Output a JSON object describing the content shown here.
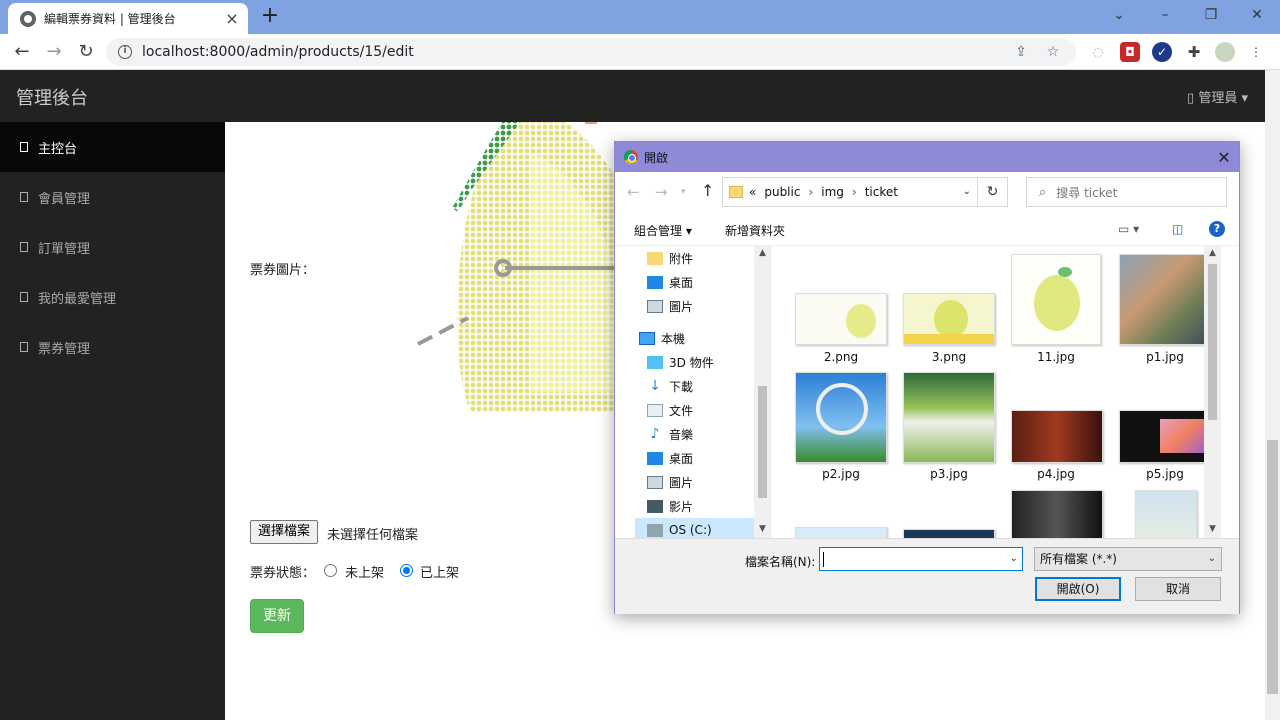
{
  "browser": {
    "tab_title": "編輯票券資料 | 管理後台",
    "url": "localhost:8000/admin/products/15/edit"
  },
  "app": {
    "brand": "管理後台",
    "admin_menu": "管理員",
    "sidebar": [
      {
        "label": "主控台",
        "active": true
      },
      {
        "label": "會員管理",
        "active": false
      },
      {
        "label": "訂單管理",
        "active": false
      },
      {
        "label": "我的最愛管理",
        "active": false
      },
      {
        "label": "票券管理",
        "active": false
      }
    ]
  },
  "form": {
    "image_label": "票券圖片：",
    "choose_file": "選擇檔案",
    "no_file": "未選擇任何檔案",
    "status_label": "票券狀態：",
    "status_options": [
      {
        "label": "未上架",
        "checked": false
      },
      {
        "label": "已上架",
        "checked": true
      }
    ],
    "submit": "更新"
  },
  "dialog": {
    "title": "開啟",
    "path": [
      "«",
      "public",
      "img",
      "ticket"
    ],
    "search_placeholder": "搜尋 ticket",
    "organize": "組合管理",
    "new_folder": "新增資料夾",
    "nav": [
      {
        "label": "附件",
        "icon": "folder-icon",
        "indent": 1
      },
      {
        "label": "桌面",
        "icon": "desktop-icon",
        "indent": 1
      },
      {
        "label": "圖片",
        "icon": "pictures-icon",
        "indent": 1
      },
      {
        "label": "本機",
        "icon": "computer-icon",
        "indent": 0
      },
      {
        "label": "3D 物件",
        "icon": "cube-icon",
        "indent": 1
      },
      {
        "label": "下載",
        "icon": "download-icon",
        "indent": 1
      },
      {
        "label": "文件",
        "icon": "document-icon",
        "indent": 1
      },
      {
        "label": "音樂",
        "icon": "music-icon",
        "indent": 1
      },
      {
        "label": "桌面",
        "icon": "desktop-icon",
        "indent": 1
      },
      {
        "label": "圖片",
        "icon": "pictures-icon",
        "indent": 1
      },
      {
        "label": "影片",
        "icon": "video-icon",
        "indent": 1
      },
      {
        "label": "OS (C:)",
        "icon": "drive-icon",
        "indent": 1
      }
    ],
    "files": [
      "2.png",
      "3.png",
      "11.jpg",
      "p1.jpg",
      "p2.jpg",
      "p3.jpg",
      "p4.jpg",
      "p5.jpg"
    ],
    "filename_label": "檔案名稱(N):",
    "filename_value": "",
    "filetype": "所有檔案 (*.*)",
    "open_button": "開啟(O)",
    "cancel_button": "取消"
  },
  "colors": {
    "tabstrip": "#7fa3e0",
    "dialog_title": "#8e8ad8",
    "sidebar": "#222222",
    "submit": "#5cb85c",
    "radio": "#0075ff"
  }
}
